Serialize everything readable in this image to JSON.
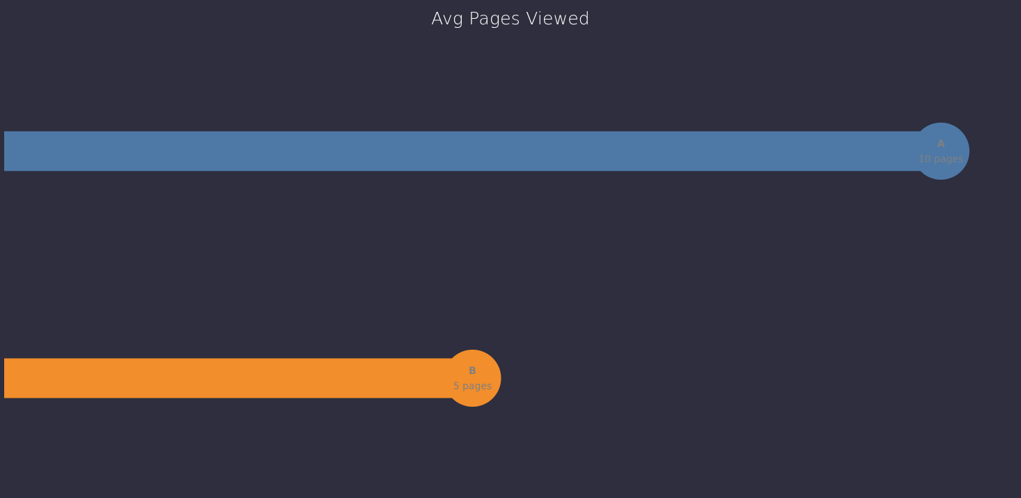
{
  "chart_data": {
    "type": "bar",
    "orientation": "horizontal",
    "title": "Avg Pages Viewed",
    "categories": [
      "A",
      "B"
    ],
    "values": [
      10,
      5
    ],
    "value_labels": [
      "10 pages",
      "5 pages"
    ],
    "colors": [
      "#4e79a7",
      "#f28e2b"
    ],
    "xlim": [
      0,
      10
    ],
    "grid": false,
    "legend": "none"
  },
  "colors": {
    "background": "#2e2e3e",
    "label_text": "#808080",
    "title_text": "#ffffff"
  }
}
